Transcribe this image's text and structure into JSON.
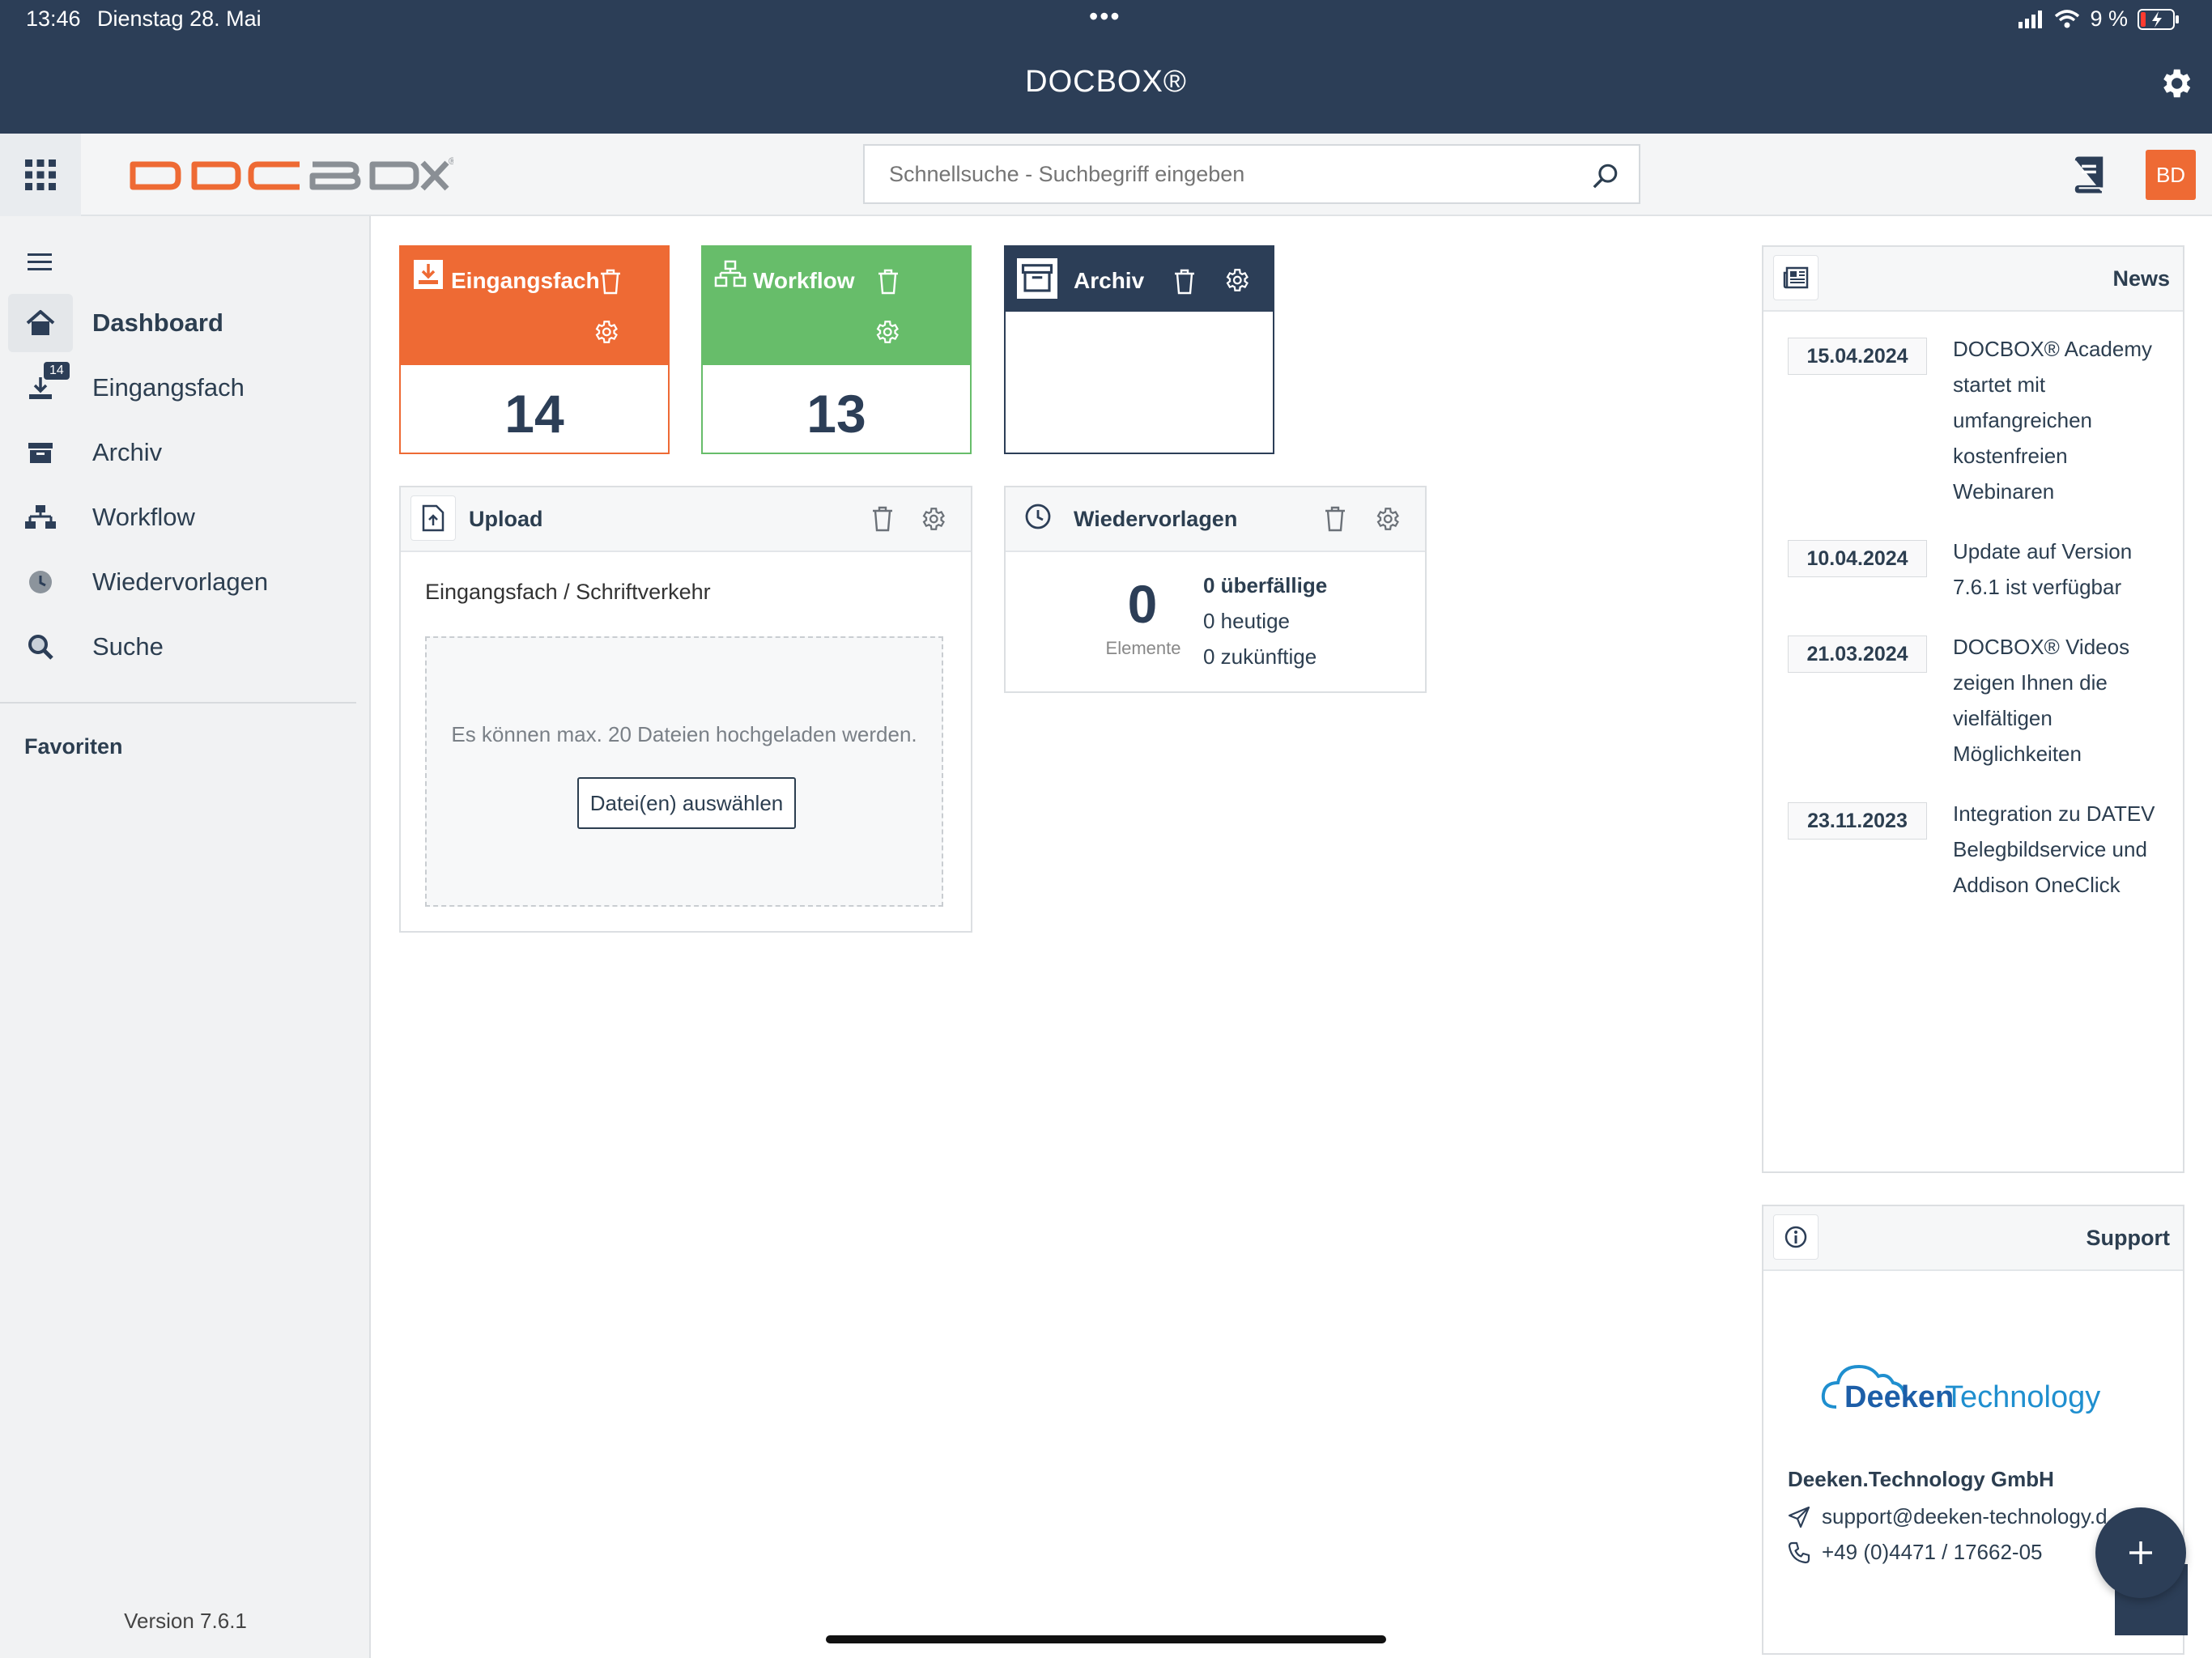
{
  "status_bar": {
    "time": "13:46",
    "date": "Dienstag 28. Mai",
    "dots": "•••",
    "battery": "9 %"
  },
  "app": {
    "title": "DOCBOX®",
    "logo_text": "DOCBOX"
  },
  "header": {
    "search_placeholder": "Schnellsuche - Suchbegriff eingeben",
    "avatar_initials": "BD"
  },
  "sidebar": {
    "items": [
      {
        "label": "Dashboard"
      },
      {
        "label": "Eingangsfach",
        "badge": "14"
      },
      {
        "label": "Archiv"
      },
      {
        "label": "Workflow"
      },
      {
        "label": "Wiedervorlagen"
      },
      {
        "label": "Suche"
      }
    ],
    "favorites": "Favoriten",
    "version": "Version 7.6.1"
  },
  "tiles": {
    "eingangsfach": {
      "title": "Eingangsfach",
      "count": "14",
      "color": "#ee6a34"
    },
    "workflow": {
      "title": "Workflow",
      "count": "13",
      "color": "#67bd6a"
    },
    "archiv": {
      "title": "Archiv",
      "count": "",
      "color": "#2c3e57"
    }
  },
  "upload": {
    "title": "Upload",
    "path": "Eingangsfach / Schriftverkehr",
    "hint": "Es können max. 20 Dateien hochgeladen werden.",
    "button": "Datei(en) auswählen"
  },
  "wiedervorlagen": {
    "title": "Wiedervorlagen",
    "count": "0",
    "elements_label": "Elemente",
    "overdue": "0 überfällige",
    "today": "0 heutige",
    "future": "0 zukünftige"
  },
  "news": {
    "title": "News",
    "items": [
      {
        "date": "15.04.2024",
        "text": "DOCBOX® Academy startet mit umfangreichen kostenfreien Webinaren"
      },
      {
        "date": "10.04.2024",
        "text": "Update auf Version 7.6.1 ist verfügbar"
      },
      {
        "date": "21.03.2024",
        "text": "DOCBOX® Videos zeigen Ihnen die vielfältigen Möglichkeiten"
      },
      {
        "date": "23.11.2023",
        "text": "Integration zu DATEV Belegbildservice und Addison OneClick"
      }
    ]
  },
  "support": {
    "title": "Support",
    "logo_main": "Deeken",
    "logo_dot": ".",
    "logo_sub": "Technology",
    "company": "Deeken.Technology GmbH",
    "email": "support@deeken-technology.d",
    "phone": "+49 (0)4471 / 17662-05"
  },
  "colors": {
    "primary": "#2c3e57",
    "accent": "#ee6a34",
    "green": "#67bd6a"
  }
}
